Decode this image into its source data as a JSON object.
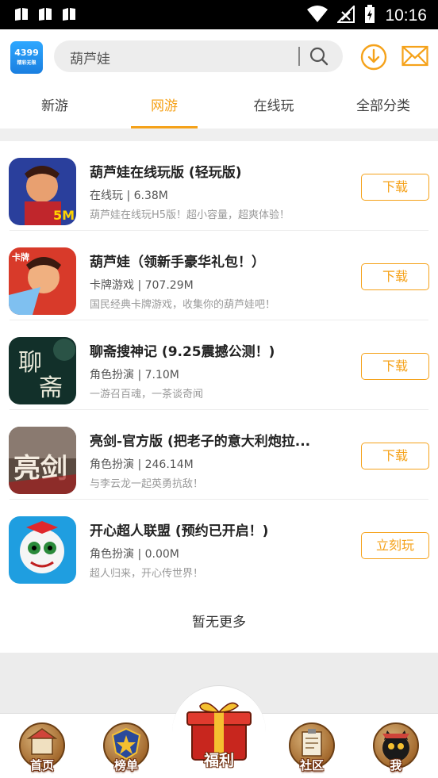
{
  "status_bar": {
    "time": "10:16",
    "icons": [
      "notification-icon",
      "notification-icon",
      "notification-icon",
      "wifi-icon",
      "signal-icon",
      "battery-charging-icon"
    ]
  },
  "header": {
    "logo_text": "4399",
    "logo_sub": "精彩无限",
    "search_placeholder": "葫芦娃",
    "icons": [
      "search-icon",
      "download-icon",
      "mail-icon"
    ]
  },
  "tabs": [
    {
      "label": "新游",
      "active": false
    },
    {
      "label": "网游",
      "active": true
    },
    {
      "label": "在线玩",
      "active": false
    },
    {
      "label": "全部分类",
      "active": false
    }
  ],
  "games": [
    {
      "name": "葫芦娃在线玩版 (轻玩版)",
      "meta": "在线玩 | 6.38M",
      "desc": "葫芦娃在线玩H5版！超小容量，超爽体验！",
      "action": "下载"
    },
    {
      "name": "葫芦娃（领新手豪华礼包！）",
      "meta": "卡牌游戏 | 707.29M",
      "desc": "国民经典卡牌游戏，收集你的葫芦娃吧！",
      "action": "下载"
    },
    {
      "name": "聊斋搜神记 (9.25震撼公测！)",
      "meta": "角色扮演 | 7.10M",
      "desc": "一游召百魂，一茶谈奇闻",
      "action": "下载"
    },
    {
      "name": "亮剑-官方版 (把老子的意大利炮拉...",
      "meta": "角色扮演 | 246.14M",
      "desc": "与李云龙一起英勇抗敌！",
      "action": "下载"
    },
    {
      "name": "开心超人联盟 (预约已开启！)",
      "meta": "角色扮演 | 0.00M",
      "desc": "超人归来，开心传世界！",
      "action": "立刻玩"
    }
  ],
  "no_more_text": "暂无更多",
  "bottom_nav": [
    {
      "label": "首页",
      "icon": "home-icon"
    },
    {
      "label": "榜单",
      "icon": "ranking-icon"
    },
    {
      "label": "福利",
      "icon": "gift-icon"
    },
    {
      "label": "社区",
      "icon": "community-icon"
    },
    {
      "label": "我",
      "icon": "profile-icon"
    }
  ],
  "colors": {
    "accent": "#f5a21a"
  }
}
